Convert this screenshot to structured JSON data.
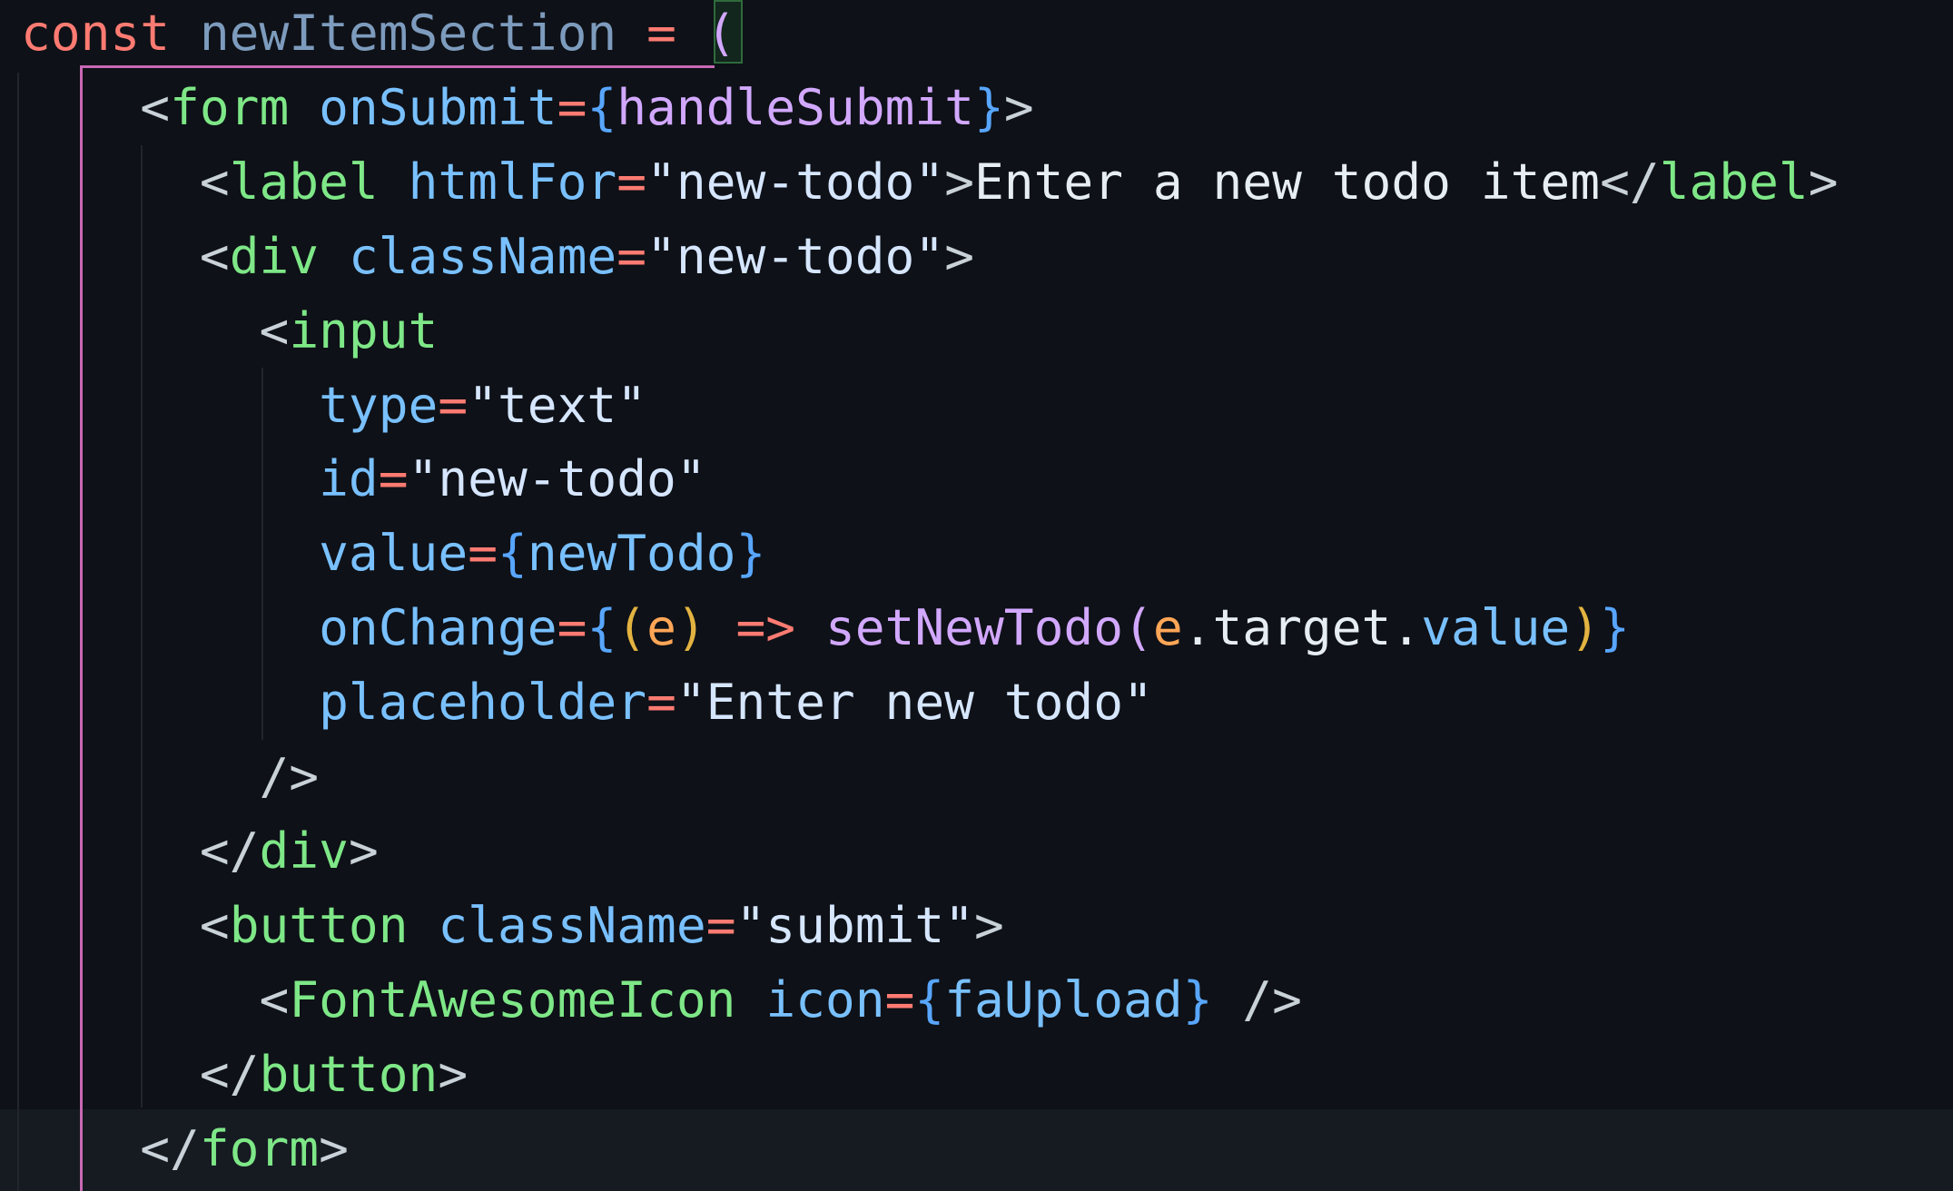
{
  "colors": {
    "background": "#0e1117",
    "bracket_guide": "#c768b4",
    "current_line": "#161b22"
  },
  "lines": [
    {
      "indent": "",
      "tokens": [
        {
          "t": "const",
          "c": "kw"
        },
        {
          "t": " ",
          "c": "text"
        },
        {
          "t": "newItemSection",
          "c": "var"
        },
        {
          "t": " ",
          "c": "text"
        },
        {
          "t": "=",
          "c": "op"
        },
        {
          "t": " ",
          "c": "text"
        },
        {
          "t": "(",
          "c": "pparen"
        }
      ]
    },
    {
      "indent": "    ",
      "tokens": [
        {
          "t": "<",
          "c": "punc"
        },
        {
          "t": "form",
          "c": "tag"
        },
        {
          "t": " ",
          "c": "text"
        },
        {
          "t": "onSubmit",
          "c": "attr"
        },
        {
          "t": "=",
          "c": "op"
        },
        {
          "t": "{",
          "c": "brace"
        },
        {
          "t": "handleSubmit",
          "c": "fn"
        },
        {
          "t": "}",
          "c": "brace"
        },
        {
          "t": ">",
          "c": "punc"
        }
      ]
    },
    {
      "indent": "      ",
      "tokens": [
        {
          "t": "<",
          "c": "punc"
        },
        {
          "t": "label",
          "c": "tag"
        },
        {
          "t": " ",
          "c": "text"
        },
        {
          "t": "htmlFor",
          "c": "attr"
        },
        {
          "t": "=",
          "c": "op"
        },
        {
          "t": "\"new-todo\"",
          "c": "str"
        },
        {
          "t": ">",
          "c": "punc"
        },
        {
          "t": "Enter a new todo item",
          "c": "text"
        },
        {
          "t": "</",
          "c": "punc"
        },
        {
          "t": "label",
          "c": "tag"
        },
        {
          "t": ">",
          "c": "punc"
        }
      ]
    },
    {
      "indent": "      ",
      "tokens": [
        {
          "t": "<",
          "c": "punc"
        },
        {
          "t": "div",
          "c": "tag"
        },
        {
          "t": " ",
          "c": "text"
        },
        {
          "t": "className",
          "c": "attr"
        },
        {
          "t": "=",
          "c": "op"
        },
        {
          "t": "\"new-todo\"",
          "c": "str"
        },
        {
          "t": ">",
          "c": "punc"
        }
      ]
    },
    {
      "indent": "        ",
      "tokens": [
        {
          "t": "<",
          "c": "punc"
        },
        {
          "t": "input",
          "c": "tag"
        }
      ]
    },
    {
      "indent": "          ",
      "tokens": [
        {
          "t": "type",
          "c": "attr"
        },
        {
          "t": "=",
          "c": "op"
        },
        {
          "t": "\"text\"",
          "c": "str"
        }
      ]
    },
    {
      "indent": "          ",
      "tokens": [
        {
          "t": "id",
          "c": "attr"
        },
        {
          "t": "=",
          "c": "op"
        },
        {
          "t": "\"new-todo\"",
          "c": "str"
        }
      ]
    },
    {
      "indent": "          ",
      "tokens": [
        {
          "t": "value",
          "c": "attr"
        },
        {
          "t": "=",
          "c": "op"
        },
        {
          "t": "{",
          "c": "brace"
        },
        {
          "t": "newTodo",
          "c": "prop"
        },
        {
          "t": "}",
          "c": "brace"
        }
      ]
    },
    {
      "indent": "          ",
      "tokens": [
        {
          "t": "onChange",
          "c": "attr"
        },
        {
          "t": "=",
          "c": "op"
        },
        {
          "t": "{",
          "c": "brace"
        },
        {
          "t": "(",
          "c": "paren"
        },
        {
          "t": "e",
          "c": "param"
        },
        {
          "t": ")",
          "c": "paren"
        },
        {
          "t": " ",
          "c": "text"
        },
        {
          "t": "=>",
          "c": "op"
        },
        {
          "t": " ",
          "c": "text"
        },
        {
          "t": "setNewTodo",
          "c": "fn"
        },
        {
          "t": "(",
          "c": "pparen"
        },
        {
          "t": "e",
          "c": "param"
        },
        {
          "t": ".target.",
          "c": "text"
        },
        {
          "t": "value",
          "c": "prop"
        },
        {
          "t": ")",
          "c": "paren"
        },
        {
          "t": "}",
          "c": "brace"
        }
      ]
    },
    {
      "indent": "          ",
      "tokens": [
        {
          "t": "placeholder",
          "c": "attr"
        },
        {
          "t": "=",
          "c": "op"
        },
        {
          "t": "\"Enter new todo\"",
          "c": "str"
        }
      ]
    },
    {
      "indent": "        ",
      "tokens": [
        {
          "t": "/>",
          "c": "punc"
        }
      ]
    },
    {
      "indent": "      ",
      "tokens": [
        {
          "t": "</",
          "c": "punc"
        },
        {
          "t": "div",
          "c": "tag"
        },
        {
          "t": ">",
          "c": "punc"
        }
      ]
    },
    {
      "indent": "      ",
      "tokens": [
        {
          "t": "<",
          "c": "punc"
        },
        {
          "t": "button",
          "c": "tag"
        },
        {
          "t": " ",
          "c": "text"
        },
        {
          "t": "className",
          "c": "attr"
        },
        {
          "t": "=",
          "c": "op"
        },
        {
          "t": "\"submit\"",
          "c": "str"
        },
        {
          "t": ">",
          "c": "punc"
        }
      ]
    },
    {
      "indent": "        ",
      "tokens": [
        {
          "t": "<",
          "c": "punc"
        },
        {
          "t": "FontAwesomeIcon",
          "c": "tag"
        },
        {
          "t": " ",
          "c": "text"
        },
        {
          "t": "icon",
          "c": "attr"
        },
        {
          "t": "=",
          "c": "op"
        },
        {
          "t": "{",
          "c": "brace"
        },
        {
          "t": "faUpload",
          "c": "prop"
        },
        {
          "t": "}",
          "c": "brace"
        },
        {
          "t": " />",
          "c": "punc"
        }
      ]
    },
    {
      "indent": "      ",
      "tokens": [
        {
          "t": "</",
          "c": "punc"
        },
        {
          "t": "button",
          "c": "tag"
        },
        {
          "t": ">",
          "c": "punc"
        }
      ]
    },
    {
      "indent": "    ",
      "tokens": [
        {
          "t": "</",
          "c": "punc"
        },
        {
          "t": "form",
          "c": "tag"
        },
        {
          "t": ">",
          "c": "punc"
        }
      ]
    }
  ]
}
